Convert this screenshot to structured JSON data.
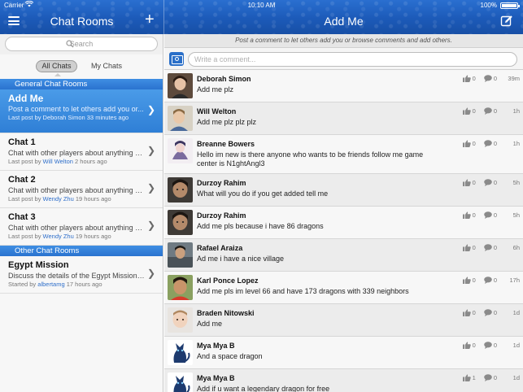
{
  "status": {
    "carrier": "Carrier",
    "time": "10:10 AM",
    "battery": "100%"
  },
  "left_header": {
    "title": "Chat Rooms"
  },
  "right_header": {
    "title": "Add Me"
  },
  "search": {
    "placeholder": "Search"
  },
  "segments": {
    "all": "All Chats",
    "my": "My Chats"
  },
  "sections": {
    "general": "General Chat Rooms",
    "other": "Other Chat Rooms"
  },
  "rooms": [
    {
      "title": "Add Me",
      "desc": "Post a comment to let others add you or...",
      "meta_prefix": "Last post by",
      "user": "Deborah Simon",
      "when": "33 minutes ago"
    },
    {
      "title": "Chat 1",
      "desc": "Chat with other players about anything yo...",
      "meta_prefix": "Last post by",
      "user": "Will Welton",
      "when": "2 hours ago"
    },
    {
      "title": "Chat 2",
      "desc": "Chat with other players about anything yo...",
      "meta_prefix": "Last post by",
      "user": "Wendy Zhu",
      "when": "19 hours ago"
    },
    {
      "title": "Chat 3",
      "desc": "Chat with other players about anything yo...",
      "meta_prefix": "Last post by",
      "user": "Wendy Zhu",
      "when": "19 hours ago"
    },
    {
      "title": "Egypt Mission",
      "desc": "Discuss the details of the Egypt Mission h...",
      "meta_prefix": "Started by",
      "user": "albertamg",
      "when": "17 hours ago"
    }
  ],
  "info_text": "Post a comment to let others add you or browse comments and add others.",
  "comment_box": {
    "placeholder": "Write a comment..."
  },
  "comments": [
    {
      "name": "Deborah Simon",
      "text": "Add me plz",
      "likes": "0",
      "replies": "0",
      "time": "39m"
    },
    {
      "name": "Will Welton",
      "text": "Add me plz plz plz",
      "likes": "0",
      "replies": "0",
      "time": "1h"
    },
    {
      "name": "Breanne Bowers",
      "text": "Hello im new is there anyone who wants to be friends follow me game center is N1ghtAngl3",
      "likes": "0",
      "replies": "0",
      "time": "1h"
    },
    {
      "name": "Durzoy Rahim",
      "text": "What will you do if you get added tell me",
      "likes": "0",
      "replies": "0",
      "time": "5h"
    },
    {
      "name": "Durzoy Rahim",
      "text": "Add me pls because i have 86 dragons",
      "likes": "0",
      "replies": "0",
      "time": "5h"
    },
    {
      "name": "Rafael Araiza",
      "text": "Ad me i have a nice village",
      "likes": "0",
      "replies": "0",
      "time": "6h"
    },
    {
      "name": "Karl Ponce Lopez",
      "text": "Add me pls im level 66 and have 173 dragons with 339 neighbors",
      "likes": "0",
      "replies": "0",
      "time": "17h"
    },
    {
      "name": "Braden Nitowski",
      "text": "Add me",
      "likes": "0",
      "replies": "0",
      "time": "1d"
    },
    {
      "name": "Mya Mya B",
      "text": "And a space dragon",
      "likes": "0",
      "replies": "0",
      "time": "1d"
    },
    {
      "name": "Mya Mya B",
      "text": "Add if u want  a legendary dragon for free",
      "likes": "1",
      "replies": "0",
      "time": "1d"
    }
  ],
  "colors": {
    "bar_blue": "#1c5ab8",
    "selection_blue": "#3a8ce0",
    "link_blue": "#2f6fca"
  }
}
